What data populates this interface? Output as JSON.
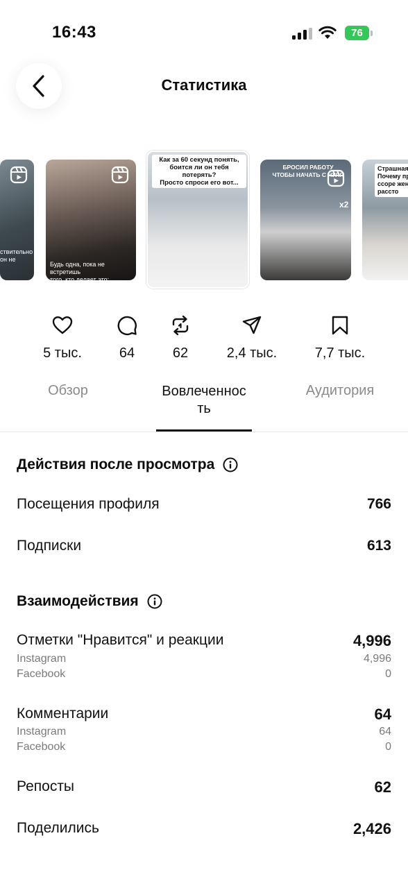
{
  "status_bar": {
    "time": "16:43",
    "battery": "76"
  },
  "header": {
    "title": "Статистика"
  },
  "thumbnails": [
    {
      "caption": "ствительно\nон не"
    },
    {
      "caption": "Будь одна, пока не встретишь\nтого, кто делает это:"
    },
    {
      "caption": "Как за 60 секунд понять,\nбоится ли он тебя потерять?\nПросто спроси его вот..."
    },
    {
      "caption": "БРОСИЛ РАБОТУ\nЧТОБЫ НАЧАТЬ С НУЛЯ",
      "badge": "x2"
    },
    {
      "caption": "Страшная\nПочему пр\nссоре жен\nрассто"
    }
  ],
  "metrics": [
    {
      "icon": "heart-icon",
      "value": "5 тыс."
    },
    {
      "icon": "comment-icon",
      "value": "64"
    },
    {
      "icon": "repost-icon",
      "value": "62"
    },
    {
      "icon": "share-icon",
      "value": "2,4 тыс."
    },
    {
      "icon": "bookmark-icon",
      "value": "7,7 тыс."
    }
  ],
  "tabs": [
    {
      "label": "Обзор"
    },
    {
      "label": "Вовлеченнос\nть"
    },
    {
      "label": "Аудитория"
    }
  ],
  "after_view": {
    "title": "Действия после просмотра",
    "rows": [
      {
        "label": "Посещения профиля",
        "value": "766"
      },
      {
        "label": "Подписки",
        "value": "613"
      }
    ]
  },
  "interactions": {
    "title": "Взаимодействия",
    "likes": {
      "label": "Отметки \"Нравится\" и реакции",
      "value": "4,996",
      "instagram_label": "Instagram",
      "instagram": "4,996",
      "facebook_label": "Facebook",
      "facebook": "0"
    },
    "comments": {
      "label": "Комментарии",
      "value": "64",
      "instagram_label": "Instagram",
      "instagram": "64",
      "facebook_label": "Facebook",
      "facebook": "0"
    },
    "reposts": {
      "label": "Репосты",
      "value": "62"
    },
    "shares": {
      "label": "Поделились",
      "value": "2,426"
    }
  },
  "colors": {
    "battery": "#35c759",
    "text": "#0c0c0c",
    "muted": "#8a8a8a"
  }
}
